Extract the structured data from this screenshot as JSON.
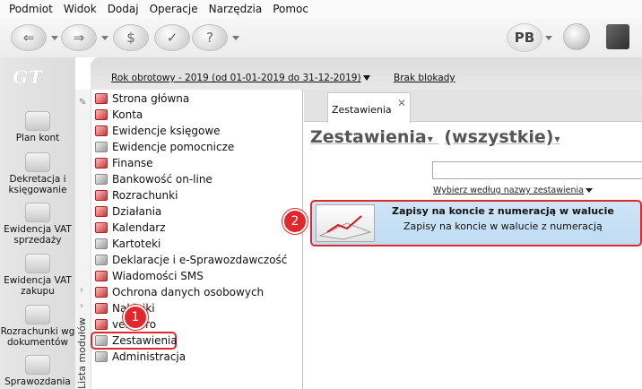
{
  "menu": [
    "Podmiot",
    "Widok",
    "Dodaj",
    "Operacje",
    "Narzędzia",
    "Pomoc"
  ],
  "toolbar": {
    "user_badge": "PB"
  },
  "left_sidebar": {
    "logo": "GT",
    "items": [
      {
        "label": "Plan kont",
        "icon": "chart-of-accounts-icon"
      },
      {
        "label": "Dekretacja i księgowanie",
        "icon": "posting-icon"
      },
      {
        "label": "Ewidencja VAT sprzedaży",
        "icon": "vat-sales-icon"
      },
      {
        "label": "Ewidencja VAT zakupu",
        "icon": "vat-purchase-icon"
      },
      {
        "label": "Rozrachunki wg dokumentów",
        "icon": "settlements-icon"
      },
      {
        "label": "Sprawozdania",
        "icon": "reports-icon"
      }
    ]
  },
  "header": {
    "fiscal_year": "Rok obrotowy - 2019  (od 01-01-2019 do 31-12-2019)",
    "lock_status": "Brak blokady"
  },
  "modules": {
    "strip_label": "Lista modułów",
    "items": [
      {
        "label": "Strona główna"
      },
      {
        "label": "Konta"
      },
      {
        "label": "Ewidencje księgowe"
      },
      {
        "label": "Ewidencje pomocnicze"
      },
      {
        "label": "Finanse"
      },
      {
        "label": "Bankowość on-line"
      },
      {
        "label": "Rozrachunki"
      },
      {
        "label": "Działania"
      },
      {
        "label": "Kalendarz"
      },
      {
        "label": "Kartoteki"
      },
      {
        "label": "Deklaracje i e-Sprawozdawczość"
      },
      {
        "label": "Wiadomości SMS"
      },
      {
        "label": "Ochrona danych osobowych"
      },
      {
        "label": "Naklejki"
      },
      {
        "label": "vendero"
      },
      {
        "label": "Zestawienia"
      },
      {
        "label": "Administracja"
      }
    ],
    "selected": "Zestawienia"
  },
  "content": {
    "tab_label": "Zestawienia",
    "title": "Zestawienia",
    "filter": "(wszystkie)",
    "search_value": "",
    "search_hint": "Wybierz według nazwy zestawienia",
    "result": {
      "title": "Zapisy na koncie z numeracją w walucie",
      "subtitle": "Zapisy na koncie w walucie z numeracją"
    }
  },
  "callouts": [
    "1",
    "2"
  ],
  "colors": {
    "highlight": "#e0282d",
    "result_bg": "#c6e0f5"
  }
}
